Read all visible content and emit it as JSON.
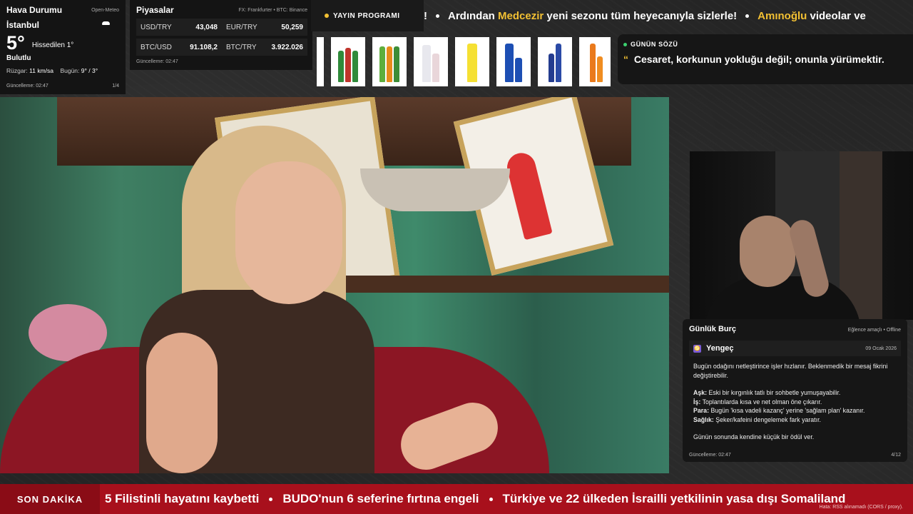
{
  "weather": {
    "title": "Hava Durumu",
    "source": "Open-Meteo",
    "city": "İstanbul",
    "temperature": "5°",
    "feels_like": "Hissedilen 1°",
    "condition": "Bulutlu",
    "wind_label": "Rüzgar:",
    "wind_value": "11 km/sa",
    "today_label": "Bugün:",
    "today_value": "9° / 3°",
    "updated": "Güncelleme: 02:47",
    "page": "1/4",
    "icon": "cloud-icon"
  },
  "markets": {
    "title": "Piyasalar",
    "source": "FX: Frankfurter • BTC: Binance",
    "items": [
      {
        "symbol": "USD/TRY",
        "value": "43,048"
      },
      {
        "symbol": "EUR/TRY",
        "value": "50,259"
      },
      {
        "symbol": "BTC/USD",
        "value": "91.108,2"
      },
      {
        "symbol": "BTC/TRY",
        "value": "3.922.026"
      }
    ],
    "updated": "Güncelleme: 02:47"
  },
  "broadcast": {
    "label": "YAYIN PROGRAMI",
    "prefix": "!",
    "part1": "Ardından",
    "highlight1": "Medcezir",
    "part2": "yeni sezonu tüm heyecanıyla sizlerle!",
    "highlight2": "Amınoğlu",
    "part3": "videolar ve",
    "accent_color": "#f2c033"
  },
  "quote": {
    "label": "GÜNÜN SÖZÜ",
    "mark": "“",
    "text": "Cesaret, korkunun yokluğu değil; onunla yürümektir."
  },
  "horoscope": {
    "title": "Günlük Burç",
    "note": "Eğlence amaçlı • Offline",
    "sign": "Yengeç",
    "sign_icon": "♋",
    "date": "09 Ocak 2026",
    "intro": "Bugün odağını netleştirince işler hızlanır. Beklenmedik bir mesaj fikrini değiştirebilir.",
    "love_label": "Aşk:",
    "love": "Eski bir kırgınlık tatlı bir sohbetle yumuşayabilir.",
    "work_label": "İş:",
    "work": "Toplantılarda kısa ve net olman öne çıkarır.",
    "money_label": "Para:",
    "money": "Bugün 'kısa vadeli kazanç' yerine 'sağlam plan' kazanır.",
    "health_label": "Sağlık:",
    "health": "Şeker/kafeini dengelemek fark yaratır.",
    "closing": "Günün sonunda kendine küçük bir ödül ver.",
    "updated": "Güncelleme: 02:47",
    "page": "4/12"
  },
  "breaking": {
    "label": "SON DAKİKA",
    "headlines": [
      "5 Filistinli hayatını kaybetti",
      "BUDO'nun 6 seferine fırtına engeli",
      "Türkiye ve 22 ülkeden İsrailli yetkilinin yasa dışı Somaliland"
    ],
    "error": "Hata: RSS alınamadı (CORS / proxy).",
    "color": "#a8101c"
  },
  "colors": {
    "accent": "#f2c033",
    "live_dot": "#3bd16f",
    "panel": "#141414"
  }
}
